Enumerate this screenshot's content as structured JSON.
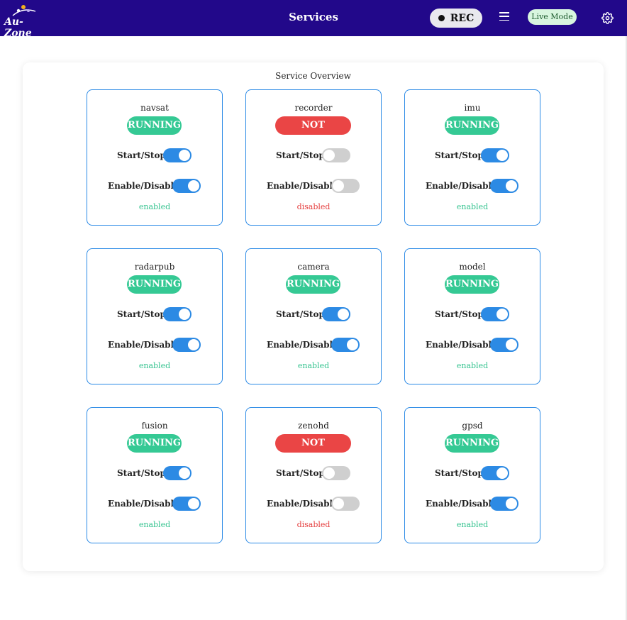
{
  "header": {
    "logo_text": "Au-Zone",
    "title": "Services",
    "rec_label": "REC",
    "mode_label": "Live Mode",
    "bg_color": "#22088a"
  },
  "overview": {
    "title": "Service Overview",
    "labels": {
      "start_stop": "Start/Stop",
      "enable_disable": "Enable/Disable"
    },
    "services": [
      {
        "name": "navsat",
        "status": "RUNNING",
        "running": true,
        "enabled": true,
        "state": "enabled"
      },
      {
        "name": "recorder",
        "status": "NOT RUNNING",
        "running": false,
        "enabled": false,
        "state": "disabled"
      },
      {
        "name": "imu",
        "status": "RUNNING",
        "running": true,
        "enabled": true,
        "state": "enabled"
      },
      {
        "name": "radarpub",
        "status": "RUNNING",
        "running": true,
        "enabled": true,
        "state": "enabled"
      },
      {
        "name": "camera",
        "status": "RUNNING",
        "running": true,
        "enabled": true,
        "state": "enabled"
      },
      {
        "name": "model",
        "status": "RUNNING",
        "running": true,
        "enabled": true,
        "state": "enabled"
      },
      {
        "name": "fusion",
        "status": "RUNNING",
        "running": true,
        "enabled": true,
        "state": "enabled"
      },
      {
        "name": "zenohd",
        "status": "NOT RUNNING",
        "running": false,
        "enabled": false,
        "state": "disabled"
      },
      {
        "name": "gpsd",
        "status": "RUNNING",
        "running": true,
        "enabled": true,
        "state": "enabled"
      }
    ]
  },
  "colors": {
    "running": "#35c994",
    "not_running": "#ea4545",
    "toggle_on": "#2c8ae4",
    "toggle_off": "#cfcfcf",
    "card_border": "#2b8ae6"
  }
}
